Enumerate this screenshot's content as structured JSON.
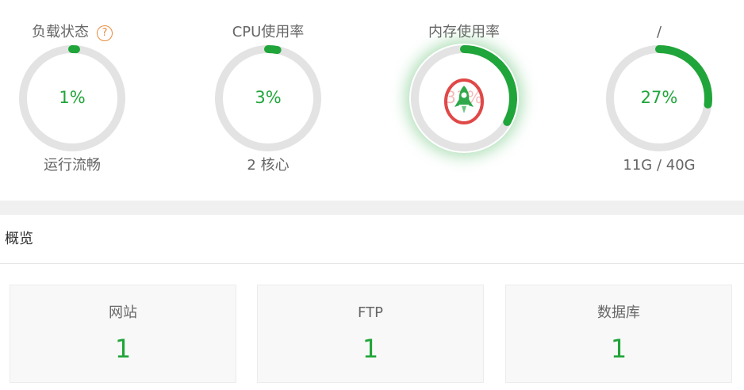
{
  "colors": {
    "accent_green": "#20a53a",
    "track_gray": "#e3e3e3",
    "help_orange": "#e88b3c",
    "boost_red": "#e04848"
  },
  "gauges": [
    {
      "title": "负载状态",
      "value": "1%",
      "percent": 1,
      "subtitle": "运行流畅",
      "help_icon": "question-icon"
    },
    {
      "title": "CPU使用率",
      "value": "3%",
      "percent": 3,
      "subtitle": "2 核心"
    },
    {
      "title": "内存使用率",
      "value": "33%",
      "percent": 33,
      "subtitle": "",
      "overlay_icon": "rocket-icon"
    },
    {
      "title": "/",
      "value": "27%",
      "percent": 27,
      "subtitle": "11G / 40G"
    }
  ],
  "overview": {
    "title": "概览",
    "cards": [
      {
        "label": "网站",
        "value": "1"
      },
      {
        "label": "FTP",
        "value": "1"
      },
      {
        "label": "数据库",
        "value": "1"
      }
    ]
  }
}
